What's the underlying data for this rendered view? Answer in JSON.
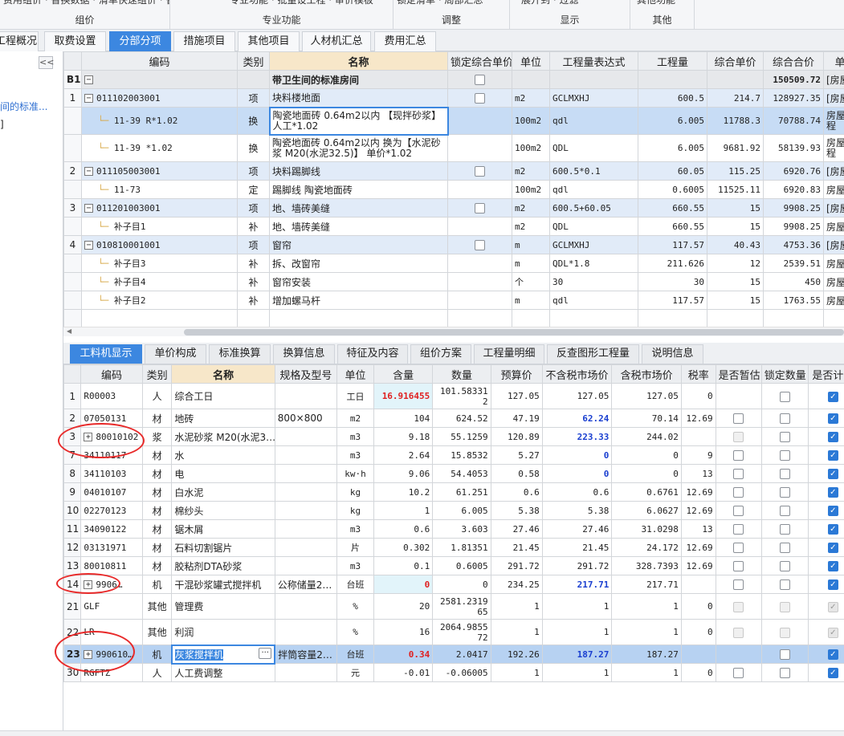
{
  "ribbon": {
    "groups": [
      {
        "label": "组价",
        "items": "费用组价 · 替换数据 · 清单快速组价 · 智能组价"
      },
      {
        "label": "专业功能",
        "items": "专业功能 · 批量设工程 · 审价模板"
      },
      {
        "label": "调整",
        "items": "锁定清单 · 局部汇总"
      },
      {
        "label": "显示",
        "items": "展开到 · 过滤"
      },
      {
        "label": "其他",
        "items": "其他功能"
      }
    ]
  },
  "tabs": [
    "工程概况",
    "取费设置",
    "分部分项",
    "措施项目",
    "其他项目",
    "人材机汇总",
    "费用汇总"
  ],
  "left_panel": {
    "collapse": "<<",
    "tree_item": "间的标准...",
    "tree_bracket": "]"
  },
  "top_table": {
    "headers": [
      "编码",
      "类别",
      "名称",
      "锁定综合单价",
      "单位",
      "工程量表达式",
      "工程量",
      "综合单价",
      "综合合价",
      "单价"
    ],
    "rows": [
      {
        "n": "B1",
        "code": "",
        "type": "",
        "name": "带卫生间的标准房间",
        "lock": true,
        "unit": "",
        "expr": "",
        "qty": "",
        "price": "",
        "total": "150509.72",
        "extra": "[房屋",
        "style": "group"
      },
      {
        "n": "1",
        "code": "011102003001",
        "type": "项",
        "name": "块料楼地面",
        "lock": true,
        "unit": "m2",
        "expr": "GCLMXHJ",
        "qty": "600.5",
        "price": "214.7",
        "total": "128927.35",
        "extra": "[房屋",
        "style": "blue"
      },
      {
        "n": "",
        "code": "11-39 R*1.02",
        "type": "换",
        "name": "陶瓷地面砖 0.64m2以内 【现拌砂浆】 人工*1.02",
        "lock": false,
        "unit": "100m2",
        "expr": "qdl",
        "qty": "6.005",
        "price": "11788.3",
        "total": "70788.74",
        "extra": "房屋工程",
        "style": "sel"
      },
      {
        "n": "",
        "code": "11-39 *1.02",
        "type": "换",
        "name": "陶瓷地面砖 0.64m2以内 换为【水泥砂浆 M20(水泥32.5)】 单价*1.02",
        "lock": false,
        "unit": "100m2",
        "expr": "QDL",
        "qty": "6.005",
        "price": "9681.92",
        "total": "58139.93",
        "extra": "房屋工程",
        "style": ""
      },
      {
        "n": "2",
        "code": "011105003001",
        "type": "项",
        "name": "块料踢脚线",
        "lock": true,
        "unit": "m2",
        "expr": "600.5*0.1",
        "qty": "60.05",
        "price": "115.25",
        "total": "6920.76",
        "extra": "[房屋",
        "style": "blue"
      },
      {
        "n": "",
        "code": "11-73",
        "type": "定",
        "name": "踢脚线 陶瓷地面砖",
        "lock": false,
        "unit": "100m2",
        "expr": "qdl",
        "qty": "0.6005",
        "price": "11525.11",
        "total": "6920.83",
        "extra": "房屋",
        "style": ""
      },
      {
        "n": "3",
        "code": "011201003001",
        "type": "项",
        "name": "地、墙砖美缝",
        "lock": true,
        "unit": "m2",
        "expr": "600.5+60.05",
        "qty": "660.55",
        "price": "15",
        "total": "9908.25",
        "extra": "[房屋",
        "style": "blue"
      },
      {
        "n": "",
        "code": "补子目1",
        "type": "补",
        "name": "地、墙砖美缝",
        "lock": false,
        "unit": "m2",
        "expr": "QDL",
        "qty": "660.55",
        "price": "15",
        "total": "9908.25",
        "extra": "房屋",
        "style": ""
      },
      {
        "n": "4",
        "code": "010810001001",
        "type": "项",
        "name": "窗帘",
        "lock": true,
        "unit": "m",
        "expr": "GCLMXHJ",
        "qty": "117.57",
        "price": "40.43",
        "total": "4753.36",
        "extra": "[房屋",
        "style": "blue"
      },
      {
        "n": "",
        "code": "补子目3",
        "type": "补",
        "name": "拆、改窗帘",
        "lock": false,
        "unit": "m",
        "expr": "QDL*1.8",
        "qty": "211.626",
        "price": "12",
        "total": "2539.51",
        "extra": "房屋",
        "style": ""
      },
      {
        "n": "",
        "code": "补子目4",
        "type": "补",
        "name": "窗帘安装",
        "lock": false,
        "unit": "个",
        "expr": "30",
        "qty": "30",
        "price": "15",
        "total": "450",
        "extra": "房屋",
        "style": ""
      },
      {
        "n": "",
        "code": "补子目2",
        "type": "补",
        "name": "增加螺马杆",
        "lock": false,
        "unit": "m",
        "expr": "qdl",
        "qty": "117.57",
        "price": "15",
        "total": "1763.55",
        "extra": "房屋",
        "style": ""
      }
    ]
  },
  "bottom_tabs": [
    "工料机显示",
    "单价构成",
    "标准换算",
    "换算信息",
    "特征及内容",
    "组价方案",
    "工程量明细",
    "反查图形工程量",
    "说明信息"
  ],
  "bottom_table": {
    "headers": [
      "编码",
      "类别",
      "名称",
      "规格及型号",
      "单位",
      "含量",
      "数量",
      "预算价",
      "不含税市场价",
      "含税市场价",
      "税率",
      "是否暂估",
      "锁定数量",
      "是否计价"
    ],
    "rows": [
      {
        "n": "1",
        "code": "R00003",
        "type": "人",
        "name": "综合工日",
        "spec": "",
        "unit": "工日",
        "content": "16.916455",
        "qty": "101.583312",
        "budget": "127.05",
        "notax": "127.05",
        "tax": "127.05",
        "rate": "0",
        "est": "none",
        "lockq": "off",
        "price": "on",
        "cstyle": "red-cyan",
        "nstyle": "",
        "exp": false
      },
      {
        "n": "2",
        "code": "07050131",
        "type": "材",
        "name": "地砖",
        "spec": "800×800",
        "unit": "m2",
        "content": "104",
        "qty": "624.52",
        "budget": "47.19",
        "notax": "62.24",
        "tax": "70.14",
        "rate": "12.69",
        "est": "off",
        "lockq": "off",
        "price": "on",
        "cstyle": "",
        "nstyle": "blue",
        "exp": false
      },
      {
        "n": "3",
        "code": "80010102",
        "type": "浆",
        "name": "水泥砂浆 M20(水泥3…",
        "spec": "",
        "unit": "m3",
        "content": "9.18",
        "qty": "55.1259",
        "budget": "120.89",
        "notax": "223.33",
        "tax": "244.02",
        "rate": "",
        "est": "dis",
        "lockq": "off",
        "price": "on",
        "cstyle": "",
        "nstyle": "blue",
        "exp": true
      },
      {
        "n": "7",
        "code": "34110117",
        "type": "材",
        "name": "水",
        "spec": "",
        "unit": "m3",
        "content": "2.64",
        "qty": "15.8532",
        "budget": "5.27",
        "notax": "0",
        "tax": "0",
        "rate": "9",
        "est": "off",
        "lockq": "off",
        "price": "on",
        "cstyle": "",
        "nstyle": "blue",
        "exp": false
      },
      {
        "n": "8",
        "code": "34110103",
        "type": "材",
        "name": "电",
        "spec": "",
        "unit": "kw·h",
        "content": "9.06",
        "qty": "54.4053",
        "budget": "0.58",
        "notax": "0",
        "tax": "0",
        "rate": "13",
        "est": "off",
        "lockq": "off",
        "price": "on",
        "cstyle": "",
        "nstyle": "blue",
        "exp": false
      },
      {
        "n": "9",
        "code": "04010107",
        "type": "材",
        "name": "白水泥",
        "spec": "",
        "unit": "kg",
        "content": "10.2",
        "qty": "61.251",
        "budget": "0.6",
        "notax": "0.6",
        "tax": "0.6761",
        "rate": "12.69",
        "est": "off",
        "lockq": "off",
        "price": "on",
        "cstyle": "",
        "nstyle": "",
        "exp": false
      },
      {
        "n": "10",
        "code": "02270123",
        "type": "材",
        "name": "棉纱头",
        "spec": "",
        "unit": "kg",
        "content": "1",
        "qty": "6.005",
        "budget": "5.38",
        "notax": "5.38",
        "tax": "6.0627",
        "rate": "12.69",
        "est": "off",
        "lockq": "off",
        "price": "on",
        "cstyle": "",
        "nstyle": "",
        "exp": false
      },
      {
        "n": "11",
        "code": "34090122",
        "type": "材",
        "name": "锯木屑",
        "spec": "",
        "unit": "m3",
        "content": "0.6",
        "qty": "3.603",
        "budget": "27.46",
        "notax": "27.46",
        "tax": "31.0298",
        "rate": "13",
        "est": "off",
        "lockq": "off",
        "price": "on",
        "cstyle": "",
        "nstyle": "",
        "exp": false
      },
      {
        "n": "12",
        "code": "03131971",
        "type": "材",
        "name": "石料切割锯片",
        "spec": "",
        "unit": "片",
        "content": "0.302",
        "qty": "1.81351",
        "budget": "21.45",
        "notax": "21.45",
        "tax": "24.172",
        "rate": "12.69",
        "est": "off",
        "lockq": "off",
        "price": "on",
        "cstyle": "",
        "nstyle": "",
        "exp": false
      },
      {
        "n": "13",
        "code": "80010811",
        "type": "材",
        "name": "胶粘剂DTA砂浆",
        "spec": "",
        "unit": "m3",
        "content": "0.1",
        "qty": "0.6005",
        "budget": "291.72",
        "notax": "291.72",
        "tax": "328.7393",
        "rate": "12.69",
        "est": "off",
        "lockq": "off",
        "price": "on",
        "cstyle": "",
        "nstyle": "",
        "exp": false
      },
      {
        "n": "14",
        "code": "9906…",
        "type": "机",
        "name": "干混砂浆罐式搅拌机",
        "spec": "公称储量2…",
        "unit": "台班",
        "content": "0",
        "qty": "0",
        "budget": "234.25",
        "notax": "217.71",
        "tax": "217.71",
        "rate": "",
        "est": "off",
        "lockq": "off",
        "price": "on",
        "cstyle": "red-cyan",
        "nstyle": "blue",
        "exp": true
      },
      {
        "n": "21",
        "code": "GLF",
        "type": "其他",
        "name": "管理费",
        "spec": "",
        "unit": "%",
        "content": "20",
        "qty": "2581.231965",
        "budget": "1",
        "notax": "1",
        "tax": "1",
        "rate": "0",
        "est": "dis",
        "lockq": "dis",
        "price": "dison",
        "cstyle": "",
        "nstyle": "",
        "exp": false
      },
      {
        "n": "22",
        "code": "LR",
        "type": "其他",
        "name": "利润",
        "spec": "",
        "unit": "%",
        "content": "16",
        "qty": "2064.985572",
        "budget": "1",
        "notax": "1",
        "tax": "1",
        "rate": "0",
        "est": "dis",
        "lockq": "dis",
        "price": "dison",
        "cstyle": "",
        "nstyle": "",
        "exp": false
      },
      {
        "n": "23",
        "code": "990610…",
        "type": "机",
        "name": "灰浆搅拌机",
        "spec": "拌筒容量2…",
        "unit": "台班",
        "content": "0.34",
        "qty": "2.0417",
        "budget": "192.26",
        "notax": "187.27",
        "tax": "187.27",
        "rate": "",
        "est": "none",
        "lockq": "off",
        "price": "on",
        "cstyle": "red",
        "nstyle": "blue",
        "exp": true,
        "sel": true
      },
      {
        "n": "30",
        "code": "RGFTZ",
        "type": "人",
        "name": "人工费调整",
        "spec": "",
        "unit": "元",
        "content": "-0.01",
        "qty": "-0.06005",
        "budget": "1",
        "notax": "1",
        "tax": "1",
        "rate": "0",
        "est": "off",
        "lockq": "off",
        "price": "on",
        "cstyle": "",
        "nstyle": "",
        "exp": false
      }
    ]
  },
  "colors": {
    "accent": "#3c87e0",
    "annotation": "#e82a2a",
    "highlight_red": "#e02020",
    "highlight_blue": "#1a3fd0"
  }
}
